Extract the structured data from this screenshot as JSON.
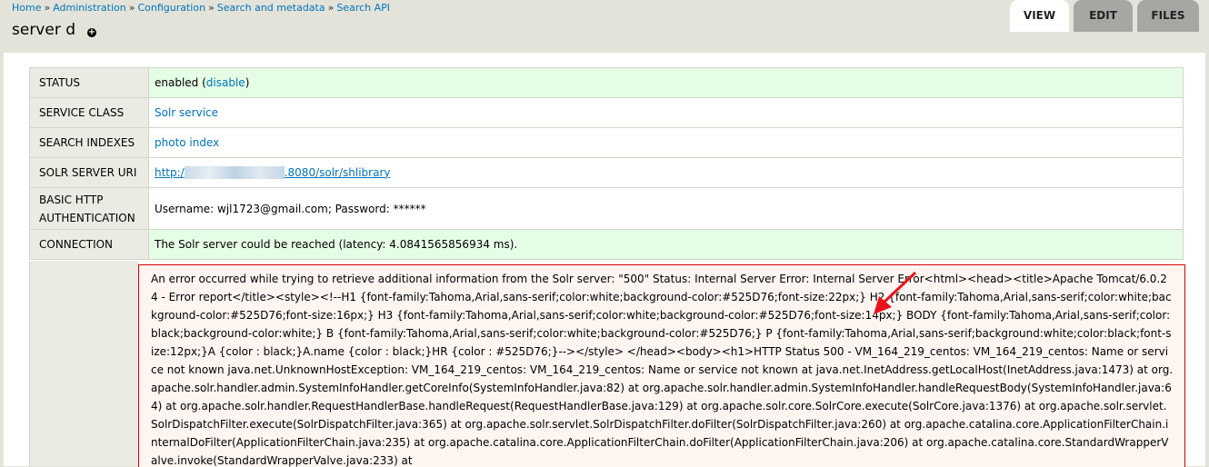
{
  "breadcrumb": {
    "items": [
      "Home",
      "Administration",
      "Configuration",
      "Search and metadata",
      "Search API"
    ],
    "separator": "»"
  },
  "title": "server d",
  "tabs": [
    {
      "label": "VIEW",
      "active": true
    },
    {
      "label": "EDIT",
      "active": false
    },
    {
      "label": "FILES",
      "active": false
    }
  ],
  "rows": {
    "status": {
      "label": "STATUS",
      "value": "enabled (",
      "link": "disable",
      "suffix": ")"
    },
    "service_class": {
      "label": "SERVICE CLASS",
      "link": "Solr service"
    },
    "search_indexes": {
      "label": "SEARCH INDEXES",
      "link": "photo index"
    },
    "solr_uri": {
      "label": "SOLR SERVER URI",
      "link_prefix": "http:/",
      "link_suffix": ".8080/solr/shlibrary"
    },
    "basic_auth": {
      "label": "BASIC HTTP AUTHENTICATION",
      "value": "Username: wjl1723@gmail.com; Password: ******"
    },
    "connection": {
      "label": "CONNECTION",
      "value": "The Solr server could be reached (latency: 4.0841565856934 ms)."
    }
  },
  "error_message": "An error occurred while trying to retrieve additional information from the Solr server: \"500\" Status: Internal Server Error: Internal Server Error<html><head><title>Apache Tomcat/6.0.24 - Error report</title><style><!--H1 {font-family:Tahoma,Arial,sans-serif;color:white;background-color:#525D76;font-size:22px;} H2 {font-family:Tahoma,Arial,sans-serif;color:white;background-color:#525D76;font-size:16px;} H3 {font-family:Tahoma,Arial,sans-serif;color:white;background-color:#525D76;font-size:14px;} BODY {font-family:Tahoma,Arial,sans-serif;color:black;background-color:white;} B {font-family:Tahoma,Arial,sans-serif;color:white;background-color:#525D76;} P {font-family:Tahoma,Arial,sans-serif;background:white;color:black;font-size:12px;}A {color : black;}A.name {color : black;}HR {color : #525D76;}--></style> </head><body><h1>HTTP Status 500 - VM_164_219_centos: VM_164_219_centos: Name or service not known java.net.UnknownHostException: VM_164_219_centos: VM_164_219_centos: Name or service not known at java.net.InetAddress.getLocalHost(InetAddress.java:1473) at org.apache.solr.handler.admin.SystemInfoHandler.getCoreInfo(SystemInfoHandler.java:82) at org.apache.solr.handler.admin.SystemInfoHandler.handleRequestBody(SystemInfoHandler.java:64) at org.apache.solr.handler.RequestHandlerBase.handleRequest(RequestHandlerBase.java:129) at org.apache.solr.core.SolrCore.execute(SolrCore.java:1376) at org.apache.solr.servlet.SolrDispatchFilter.execute(SolrDispatchFilter.java:365) at org.apache.solr.servlet.SolrDispatchFilter.doFilter(SolrDispatchFilter.java:260) at org.apache.catalina.core.ApplicationFilterChain.internalDoFilter(ApplicationFilterChain.java:235) at org.apache.catalina.core.ApplicationFilterChain.doFilter(ApplicationFilterChain.java:206) at org.apache.catalina.core.StandardWrapperValve.invoke(StandardWrapperValve.java:233) at",
  "colors": {
    "link": "#0074bd",
    "ok_row": "#e5fde5",
    "error_border": "#d40000",
    "error_bg": "#fef5f1",
    "annotation_arrow": "#e8141b"
  }
}
